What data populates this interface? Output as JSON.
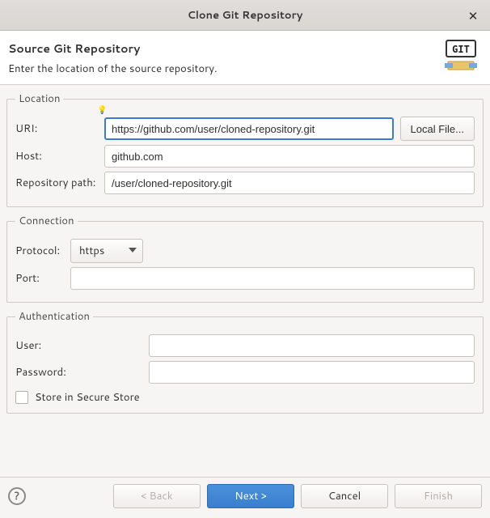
{
  "titlebar": {
    "title": "Clone Git Repository"
  },
  "header": {
    "title": "Source Git Repository",
    "subtitle": "Enter the location of the source repository."
  },
  "location": {
    "legend": "Location",
    "uri_label": "URI:",
    "uri_value": "https://github.com/user/cloned-repository.git",
    "local_file_label": "Local File...",
    "host_label": "Host:",
    "host_value": "github.com",
    "repo_path_label": "Repository path:",
    "repo_path_value": "/user/cloned-repository.git"
  },
  "connection": {
    "legend": "Connection",
    "protocol_label": "Protocol:",
    "protocol_value": "https",
    "port_label": "Port:",
    "port_value": ""
  },
  "authentication": {
    "legend": "Authentication",
    "user_label": "User:",
    "user_value": "",
    "password_label": "Password:",
    "password_value": "",
    "store_label": "Store in Secure Store"
  },
  "footer": {
    "back_label": "< Back",
    "next_label": "Next >",
    "cancel_label": "Cancel",
    "finish_label": "Finish"
  }
}
